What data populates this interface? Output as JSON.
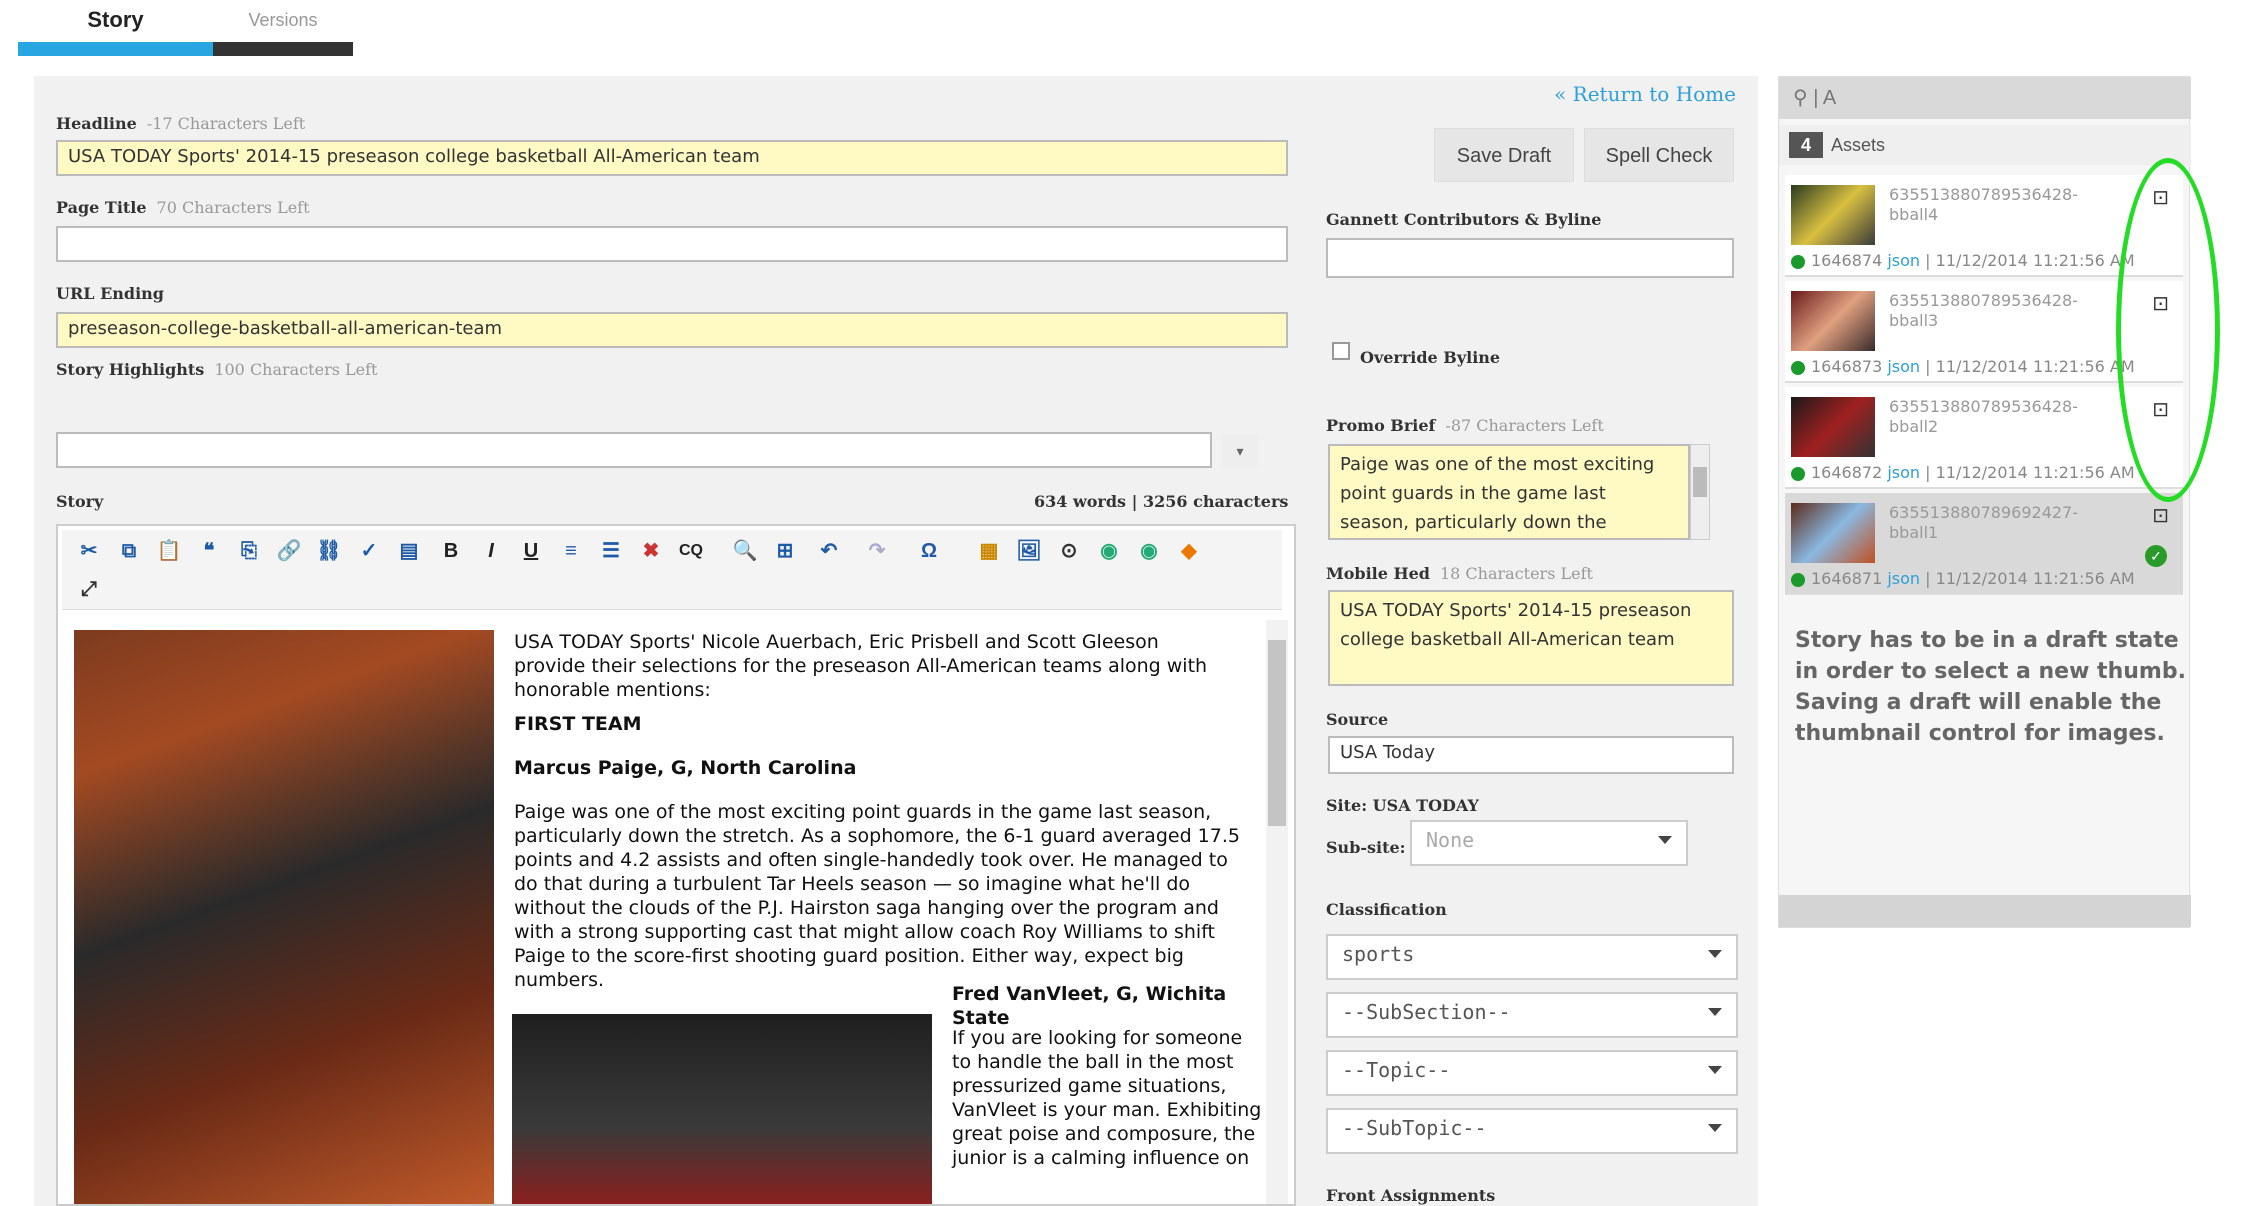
{
  "tabs": {
    "story": "Story",
    "versions": "Versions"
  },
  "header": {
    "return_link": "« Return to Home",
    "save_draft": "Save Draft",
    "spell_check": "Spell Check"
  },
  "headline": {
    "label": "Headline",
    "hint": "-17 Characters Left",
    "value": "USA TODAY Sports' 2014-15 preseason college basketball All-American team"
  },
  "page_title": {
    "label": "Page Title",
    "hint": "70 Characters Left",
    "value": ""
  },
  "url_ending": {
    "label": "URL Ending",
    "value": "preseason-college-basketball-all-american-team"
  },
  "highlights": {
    "label": "Story Highlights",
    "hint": "100 Characters Left",
    "value": ""
  },
  "story": {
    "label": "Story",
    "counts": "634 words | 3256 characters",
    "intro": "USA TODAY Sports' Nicole Auerbach, Eric Prisbell and Scott Gleeson provide their selections for the preseason All-American teams along with honorable mentions:",
    "section": "FIRST TEAM",
    "player1": "Marcus Paige, G, North Carolina",
    "para1": "Paige was one of the most exciting point guards in the game last season, particularly down the stretch. As a sophomore, the 6-1 guard averaged 17.5 points and 4.2 assists and often single-handedly took over. He managed to do that during a turbulent Tar Heels season — so imagine what he'll do without the clouds of the P.J. Hairston saga hanging over the program and with a strong supporting cast that might allow coach Roy Williams to shift Paige to the score-first shooting guard position. Either way, expect big numbers.",
    "player2": "Fred VanVleet, G, Wichita State",
    "para2": "If you are looking for someone to handle the ball in the most pressurized game situations, VanVleet is your man. Exhibiting great poise and composure, the junior is a calming influence on"
  },
  "right_form": {
    "contributors_label": "Gannett Contributors & Byline",
    "contributors_value": "",
    "override_byline": "Override Byline",
    "promo_label": "Promo Brief",
    "promo_hint": "-87 Characters Left",
    "promo_value": "Paige was one of the most exciting point guards in the game last season, particularly down the stretch. As a",
    "mobile_label": "Mobile Hed",
    "mobile_hint": "18 Characters Left",
    "mobile_value": "USA TODAY Sports' 2014-15 preseason college basketball All-American team",
    "source_label": "Source",
    "source_value": "USA Today",
    "site_label": "Site: USA TODAY",
    "subsite_label": "Sub-site:",
    "subsite_value": "None",
    "classification_label": "Classification",
    "classification_value": "sports",
    "subsection": "--SubSection--",
    "topic": "--Topic--",
    "subtopic": "--SubTopic--",
    "front_label": "Front Assignments"
  },
  "assets": {
    "search": "| A",
    "count": "4",
    "label": "Assets",
    "items": [
      {
        "name": "635513880789536428-bball4",
        "id": "1646874",
        "type": "json",
        "date": "11/12/2014 11:21:56 AM"
      },
      {
        "name": "635513880789536428-bball3",
        "id": "1646873",
        "type": "json",
        "date": "11/12/2014 11:21:56 AM"
      },
      {
        "name": "635513880789536428-bball2",
        "id": "1646872",
        "type": "json",
        "date": "11/12/2014 11:21:56 AM"
      },
      {
        "name": "635513880789692427-bball1",
        "id": "1646871",
        "type": "json",
        "date": "11/12/2014 11:21:56 AM"
      }
    ],
    "note": "Story has to be in a draft state in order to select a new thumb. Saving a draft will enable the thumbnail control for images."
  },
  "colors": {
    "accent": "#27a6e1",
    "highlight": "#25dc25",
    "yellow_field": "#fff9c4"
  }
}
